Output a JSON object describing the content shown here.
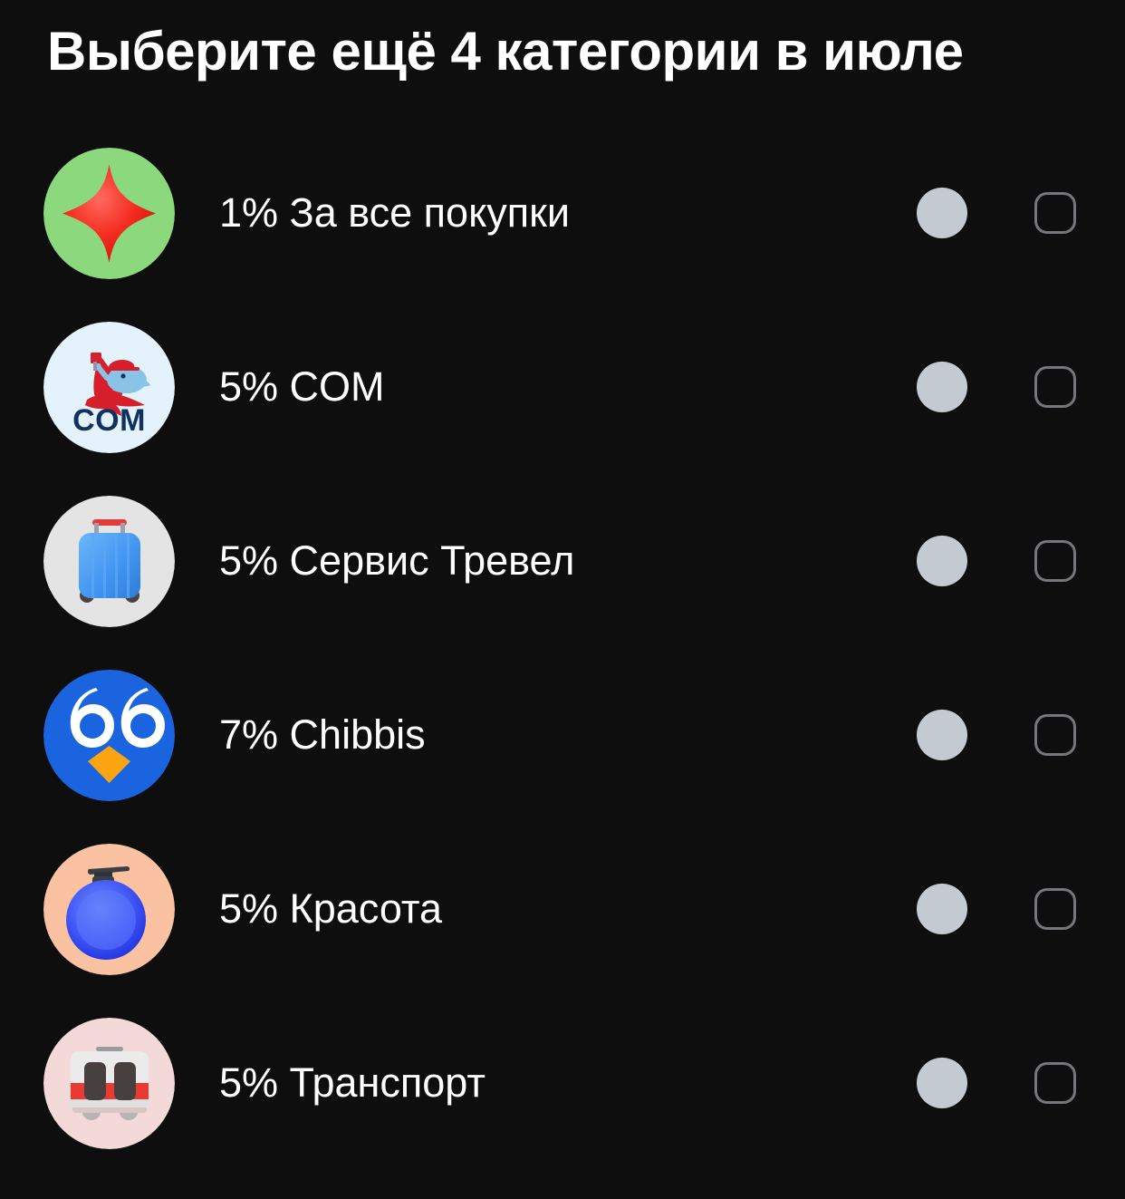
{
  "header": {
    "title": "Выберите ещё 4 категории в июле"
  },
  "theme": {
    "background": "#0e0e0e",
    "text_primary": "#ffffff",
    "info_badge": "#c3cad2",
    "checkbox_border": "#76767d"
  },
  "controls": {
    "info_icon_name": "info-icon",
    "checkbox_name": "category-checkbox",
    "checkbox_checked": false
  },
  "categories": [
    {
      "label": "1% За все покупки",
      "percent": "1%",
      "name": "За все покупки",
      "icon": "sparkle-star-icon",
      "icon_bg": "#8cd97d",
      "icon_fg": "#f5352b",
      "selected": false
    },
    {
      "label": "5% COM",
      "percent": "5%",
      "name": "COM",
      "icon": "com-fish-logo-icon",
      "icon_bg": "#e3f2fb",
      "icon_fg": "#11315f",
      "selected": false
    },
    {
      "label": "5% Сервис Тревел",
      "percent": "5%",
      "name": "Сервис Тревел",
      "icon": "suitcase-icon",
      "icon_bg": "#e4e4e4",
      "icon_fg": "#4ba3f5",
      "selected": false
    },
    {
      "label": "7% Chibbis",
      "percent": "7%",
      "name": "Chibbis",
      "icon": "owl-66-logo-icon",
      "icon_bg": "#1b64e0",
      "icon_fg": "#ffffff",
      "selected": false
    },
    {
      "label": "5% Красота",
      "percent": "5%",
      "name": "Красота",
      "icon": "soap-dispenser-icon",
      "icon_bg": "#fac2a1",
      "icon_fg": "#3f5bf5",
      "selected": false
    },
    {
      "label": "5% Транспорт",
      "percent": "5%",
      "name": "Транспорт",
      "icon": "tram-icon",
      "icon_bg": "#f3d9d7",
      "icon_fg": "#ec3a35",
      "selected": false
    }
  ]
}
